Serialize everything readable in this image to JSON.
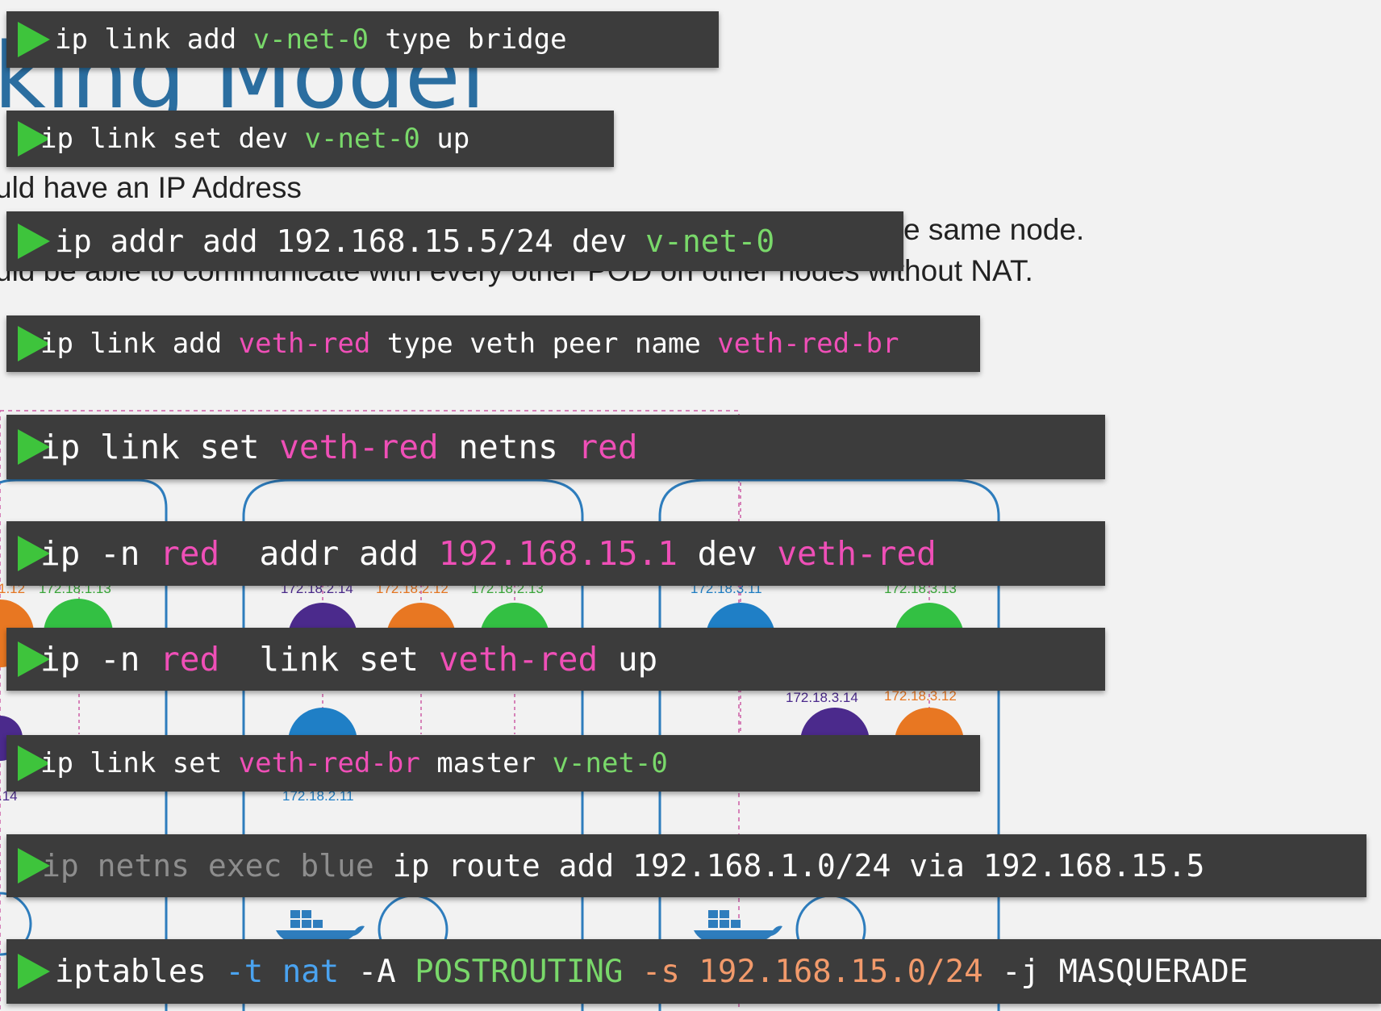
{
  "slide": {
    "title": "king Model",
    "bullets": [
      "uld have an IP Address",
      "e same node.",
      "uld be able to communicate with every other POD on other nodes without NAT."
    ]
  },
  "diagram": {
    "ip_labels": [
      {
        "text": "1.12",
        "color": "#e87722"
      },
      {
        "text": "172.18.1.13",
        "color": "#3aa83a"
      },
      {
        "text": "172.18.2.14",
        "color": "#4b2a8c"
      },
      {
        "text": "172.18.2.12",
        "color": "#e87722"
      },
      {
        "text": "172.18.2.13",
        "color": "#3aa83a"
      },
      {
        "text": "172.18.3.11",
        "color": "#1f7fc6"
      },
      {
        "text": "172.18.3.13",
        "color": "#3aa83a"
      },
      {
        "text": "172.18.3.14",
        "color": "#4b2a8c"
      },
      {
        "text": "172.18.3.12",
        "color": "#e87722"
      },
      {
        "text": ".14",
        "color": "#4b2a8c"
      },
      {
        "text": "172.18.2.11",
        "color": "#1f7fc6"
      }
    ],
    "pod_colors": {
      "orange": "#e87722",
      "green": "#33c043",
      "purple": "#4b2a8c",
      "blue": "#1f7fc6"
    }
  },
  "commands": [
    {
      "id": "bridge-add",
      "parts": [
        {
          "t": "ip link add ",
          "c": "w"
        },
        {
          "t": "v-net-0",
          "c": "g"
        },
        {
          "t": " type bridge",
          "c": "w"
        }
      ]
    },
    {
      "id": "bridge-up",
      "parts": [
        {
          "t": "ip link set dev ",
          "c": "w"
        },
        {
          "t": "v-net-0",
          "c": "g"
        },
        {
          "t": " up",
          "c": "w"
        }
      ]
    },
    {
      "id": "bridge-addr",
      "parts": [
        {
          "t": "ip addr add 192.168.15.5/24 dev ",
          "c": "w"
        },
        {
          "t": "v-net-0",
          "c": "g"
        }
      ]
    },
    {
      "id": "veth-add",
      "parts": [
        {
          "t": "ip link add ",
          "c": "w"
        },
        {
          "t": "veth-red",
          "c": "p"
        },
        {
          "t": " type veth peer name ",
          "c": "w"
        },
        {
          "t": "veth-red-br",
          "c": "p"
        }
      ]
    },
    {
      "id": "veth-netns",
      "parts": [
        {
          "t": "ip link set ",
          "c": "w"
        },
        {
          "t": "veth-red",
          "c": "p"
        },
        {
          "t": " netns ",
          "c": "w"
        },
        {
          "t": "red",
          "c": "p"
        }
      ]
    },
    {
      "id": "veth-addr",
      "parts": [
        {
          "t": "ip -n ",
          "c": "w"
        },
        {
          "t": "red",
          "c": "p"
        },
        {
          "t": "  addr add ",
          "c": "w"
        },
        {
          "t": "192.168.15.1",
          "c": "p"
        },
        {
          "t": " dev ",
          "c": "w"
        },
        {
          "t": "veth-red",
          "c": "p"
        }
      ]
    },
    {
      "id": "veth-up",
      "parts": [
        {
          "t": "ip -n ",
          "c": "w"
        },
        {
          "t": "red",
          "c": "p"
        },
        {
          "t": "  link set ",
          "c": "w"
        },
        {
          "t": "veth-red",
          "c": "p"
        },
        {
          "t": " up",
          "c": "w"
        }
      ]
    },
    {
      "id": "veth-master",
      "parts": [
        {
          "t": "ip link set ",
          "c": "w"
        },
        {
          "t": "veth-red-br",
          "c": "p"
        },
        {
          "t": " master ",
          "c": "w"
        },
        {
          "t": "v-net-0",
          "c": "g"
        }
      ]
    },
    {
      "id": "route-add",
      "parts": [
        {
          "t": "ip netns exec blue ",
          "c": "d"
        },
        {
          "t": "ip route add 192.168.1.0/24 via 192.168.15.5",
          "c": "w"
        }
      ]
    },
    {
      "id": "iptables-nat",
      "parts": [
        {
          "t": "iptables ",
          "c": "w"
        },
        {
          "t": "-t",
          "c": "b"
        },
        {
          "t": " ",
          "c": "w"
        },
        {
          "t": "nat",
          "c": "b"
        },
        {
          "t": " -A ",
          "c": "w"
        },
        {
          "t": "POSTROUTING",
          "c": "g"
        },
        {
          "t": " ",
          "c": "w"
        },
        {
          "t": "-s",
          "c": "o"
        },
        {
          "t": " ",
          "c": "w"
        },
        {
          "t": "192.168.15.0/24",
          "c": "o"
        },
        {
          "t": " -j MASQUERADE",
          "c": "w"
        }
      ]
    }
  ]
}
